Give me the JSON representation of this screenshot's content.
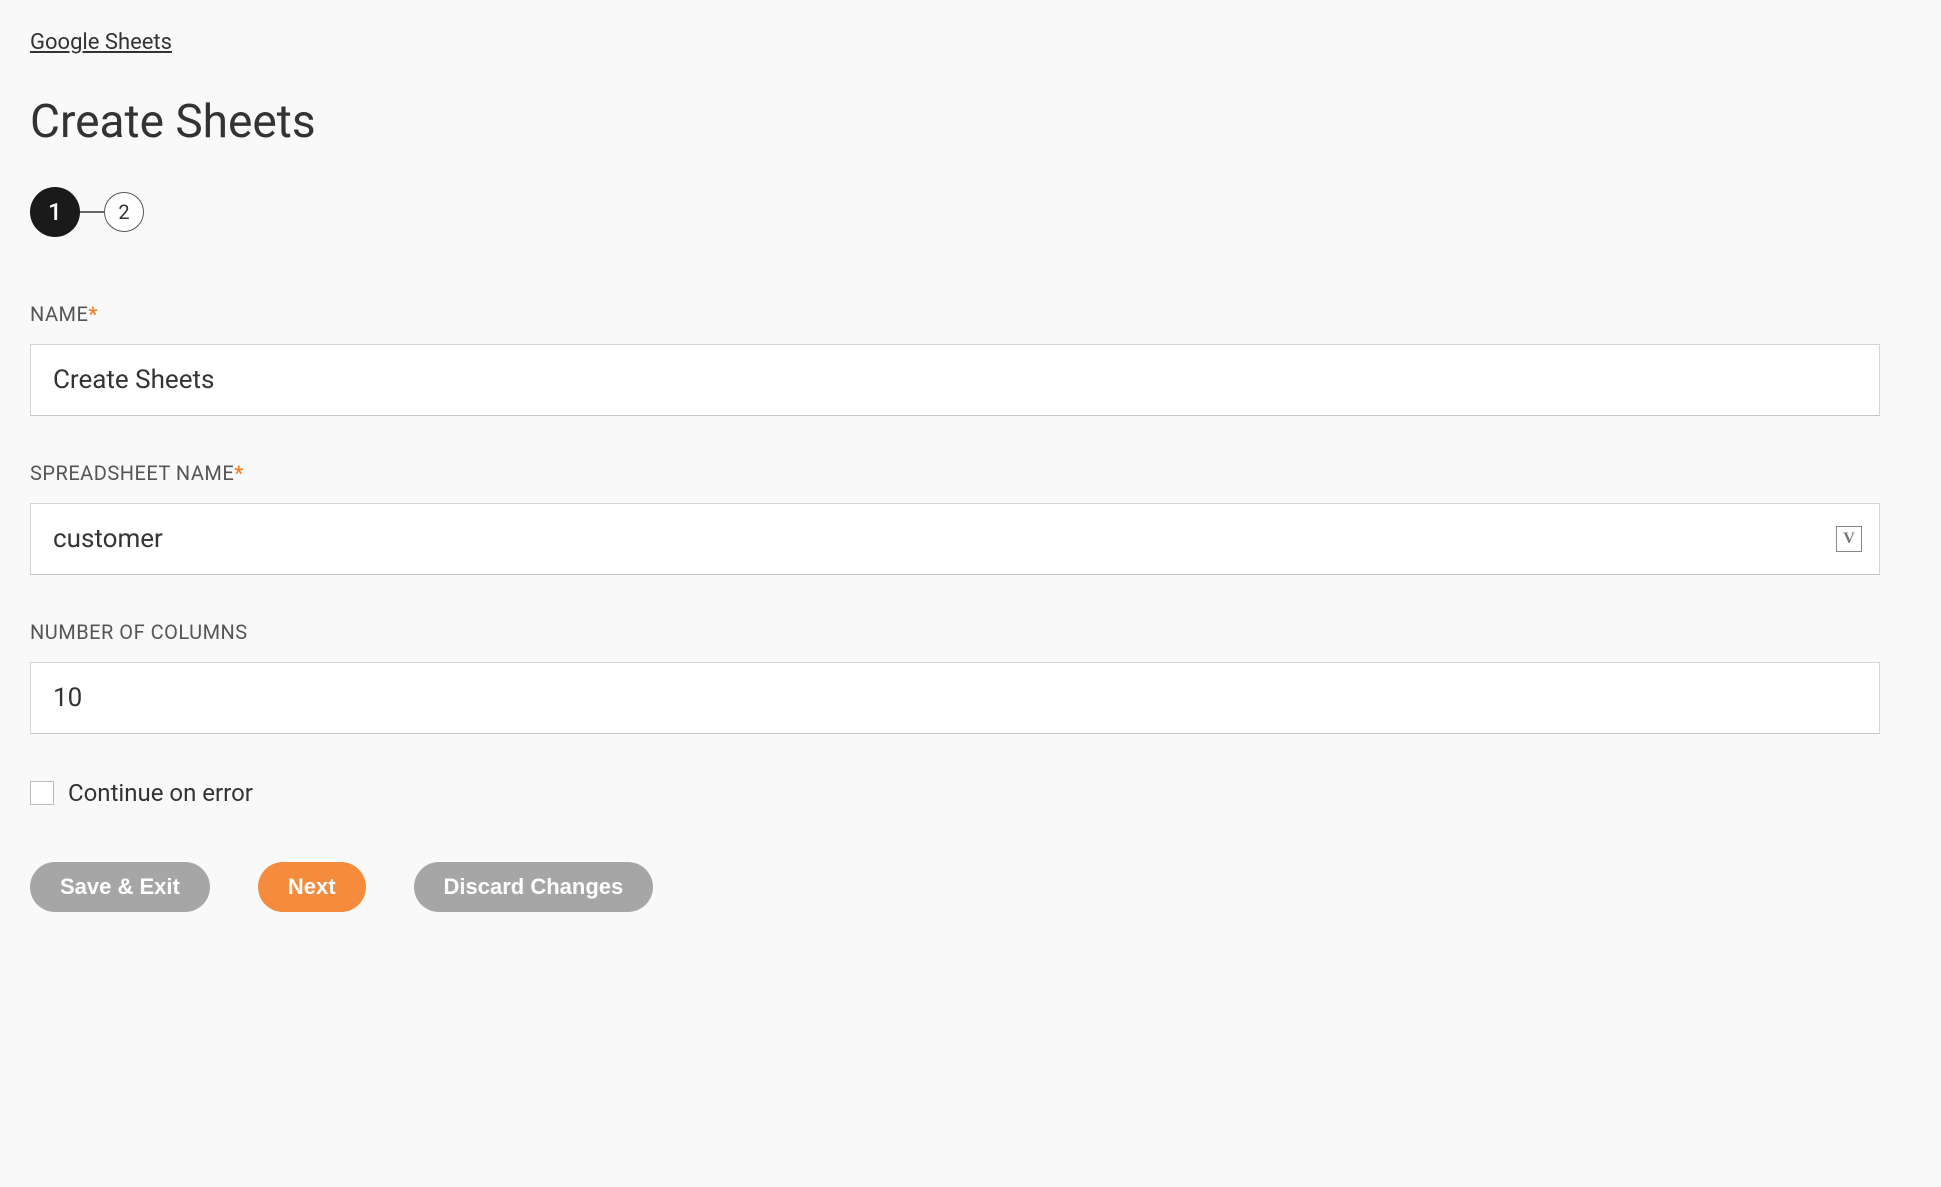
{
  "breadcrumb": {
    "parent": "Google Sheets"
  },
  "page": {
    "title": "Create Sheets"
  },
  "stepper": {
    "step1": "1",
    "step2": "2"
  },
  "labels": {
    "name": "NAME",
    "spreadsheet_name": "SPREADSHEET NAME",
    "number_of_columns": "NUMBER OF COLUMNS",
    "continue_on_error": "Continue on error",
    "required": "*"
  },
  "fields": {
    "name": "Create Sheets",
    "spreadsheet_name": "customer",
    "number_of_columns": "10"
  },
  "buttons": {
    "save_exit": "Save & Exit",
    "next": "Next",
    "discard": "Discard Changes"
  },
  "icons": {
    "variable": "V"
  }
}
